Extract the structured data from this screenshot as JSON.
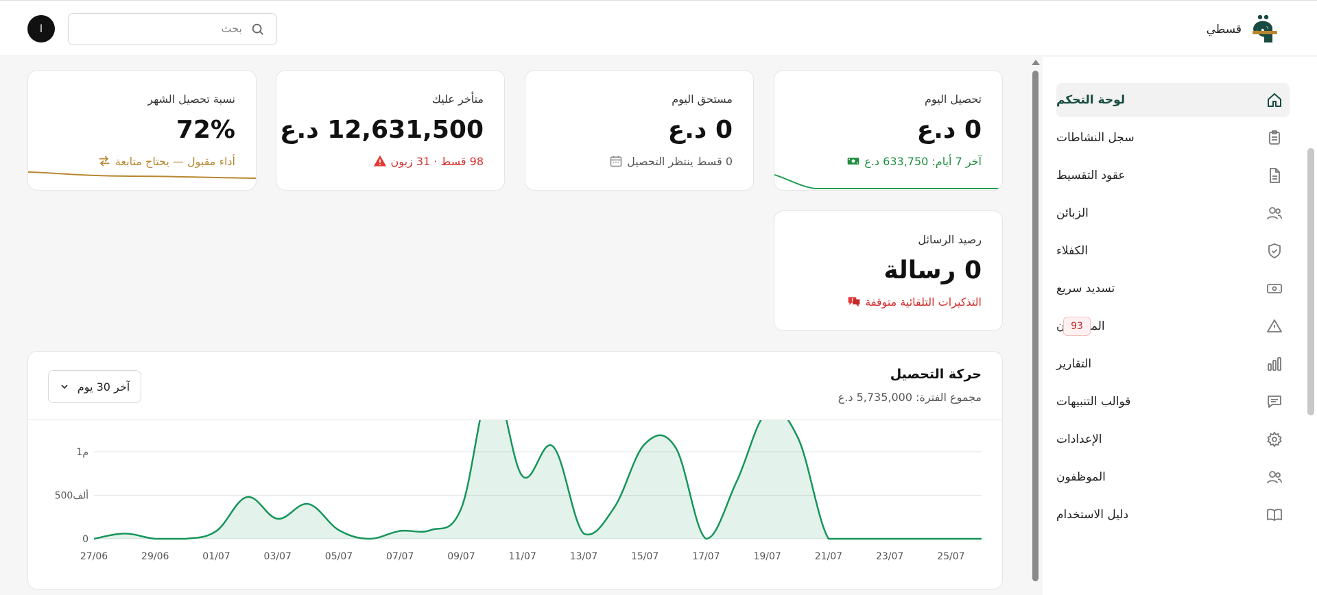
{
  "header": {
    "avatar_initial": "ا",
    "search_placeholder": "بحث",
    "brand_name": "قسطي"
  },
  "sidebar": {
    "items": [
      {
        "label": "لوحة التحكم",
        "icon": "home-icon",
        "active": true
      },
      {
        "label": "سجل النشاطات",
        "icon": "clipboard-icon"
      },
      {
        "label": "عقود التقسيط",
        "icon": "document-icon"
      },
      {
        "label": "الزبائن",
        "icon": "users-icon"
      },
      {
        "label": "الكفلاء",
        "icon": "shield-icon"
      },
      {
        "label": "تسديد سريع",
        "icon": "banknote-icon"
      },
      {
        "label": "المتأخرون",
        "icon": "warning-icon",
        "badge": "93"
      },
      {
        "label": "التقارير",
        "icon": "bar-chart-icon"
      },
      {
        "label": "قوالب التنبيهات",
        "icon": "message-icon"
      },
      {
        "label": "الإعدادات",
        "icon": "gear-icon"
      },
      {
        "label": "الموظفون",
        "icon": "users-icon"
      },
      {
        "label": "دليل الاستخدام",
        "icon": "book-icon"
      }
    ]
  },
  "cards": {
    "today_collection": {
      "title": "تحصيل اليوم",
      "value": "0 د.ع",
      "sub": "آخر 7 أيام: 633,750 د.ع",
      "sub_icon": "cash-icon"
    },
    "due_today": {
      "title": "مستحق اليوم",
      "value": "0 د.ع",
      "sub": "0 قسط ينتظر التحصيل",
      "sub_icon": "calendar-icon"
    },
    "overdue": {
      "title": "متأخر عليك",
      "value": "12,631,500 د.ع",
      "sub": "98 قسط · 31 زبون",
      "sub_icon": "alert-icon"
    },
    "month_rate": {
      "title": "نسبة تحصيل الشهر",
      "value": "72%",
      "sub": "أداء مقبول — يحتاج متابعة",
      "sub_icon": "swap-icon"
    },
    "sms_balance": {
      "title": "رصيد الرسائل",
      "value": "0 رسالة",
      "sub": "التذكيرات التلقائية متوقفة",
      "sub_icon": "chat-alert-icon"
    }
  },
  "chart": {
    "title": "حركة التحصيل",
    "subtitle": "مجموع الفترة: 5,735,000 د.ع",
    "period_label": "آخر 30 يوم"
  },
  "colors": {
    "brand": "#174a40",
    "success": "#1e8e3e",
    "danger": "#d32f2f",
    "warning": "#b8862e",
    "chart_line": "#16955a"
  },
  "chart_data": {
    "type": "area",
    "x": [
      "27/06",
      "28/06",
      "29/06",
      "30/06",
      "01/07",
      "02/07",
      "03/07",
      "04/07",
      "05/07",
      "06/07",
      "07/07",
      "08/07",
      "09/07",
      "10/07",
      "11/07",
      "12/07",
      "13/07",
      "14/07",
      "15/07",
      "16/07",
      "17/07",
      "18/07",
      "19/07",
      "20/07",
      "21/07",
      "22/07",
      "23/07",
      "24/07",
      "25/07",
      "26/07"
    ],
    "xticks": [
      "27/06",
      "29/06",
      "01/07",
      "03/07",
      "05/07",
      "07/07",
      "09/07",
      "11/07",
      "13/07",
      "15/07",
      "17/07",
      "19/07",
      "21/07",
      "23/07",
      "25/07"
    ],
    "yticks": [
      "0",
      "500ألف",
      "1م"
    ],
    "values": [
      0,
      60000,
      0,
      0,
      90000,
      480000,
      230000,
      400000,
      100000,
      0,
      90000,
      100000,
      350000,
      1790000,
      720000,
      1060000,
      60000,
      360000,
      1090000,
      1050000,
      0,
      660000,
      1460000,
      1160000,
      0,
      0,
      0,
      0,
      0,
      0
    ],
    "ylim": [
      0,
      1000000
    ],
    "grid": true,
    "series": [
      {
        "values": []
      }
    ]
  }
}
